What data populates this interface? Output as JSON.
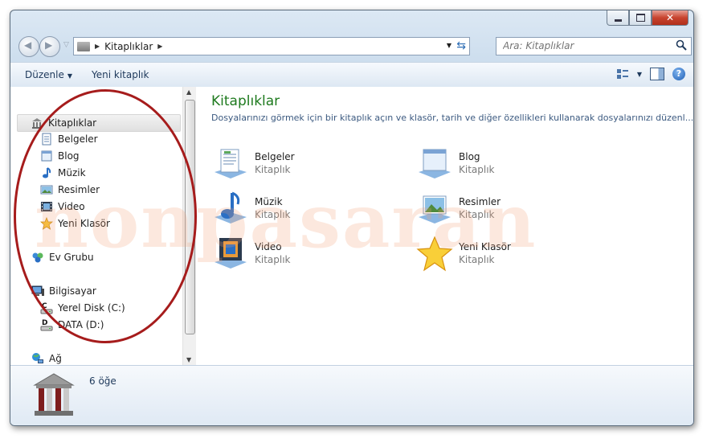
{
  "window": {
    "minimize": "minimize",
    "maximize": "maximize",
    "close": "close"
  },
  "address": {
    "crumb": "Kitaplıklar"
  },
  "search": {
    "placeholder": "Ara: Kitaplıklar"
  },
  "toolbar": {
    "organize_label": "Düzenle",
    "new_library_label": "Yeni kitaplık"
  },
  "sidebar": {
    "items": [
      {
        "label": "Kitaplıklar",
        "icon": "libraries-icon"
      },
      {
        "label": "Belgeler",
        "icon": "documents-icon"
      },
      {
        "label": "Blog",
        "icon": "blog-icon"
      },
      {
        "label": "Müzik",
        "icon": "music-icon"
      },
      {
        "label": "Resimler",
        "icon": "pictures-icon"
      },
      {
        "label": "Video",
        "icon": "video-icon"
      },
      {
        "label": "Yeni Klasör",
        "icon": "star-icon"
      },
      {
        "label": "Ev Grubu",
        "icon": "homegroup-icon"
      },
      {
        "label": "Bilgisayar",
        "icon": "computer-icon"
      },
      {
        "label": "Yerel Disk (C:)",
        "icon": "drive-c-icon"
      },
      {
        "label": "DATA (D:)",
        "icon": "drive-d-icon"
      },
      {
        "label": "Ağ",
        "icon": "network-icon"
      }
    ]
  },
  "main": {
    "title": "Kitaplıklar",
    "description": "Dosyalarınızı görmek için bir kitaplık açın ve klasör, tarih ve diğer özellikleri kullanarak dosyalarınızı düzenl...",
    "libraries": [
      {
        "name": "Belgeler",
        "kind": "Kitaplık",
        "icon": "documents-icon"
      },
      {
        "name": "Blog",
        "kind": "Kitaplık",
        "icon": "blog-icon"
      },
      {
        "name": "Müzik",
        "kind": "Kitaplık",
        "icon": "music-icon"
      },
      {
        "name": "Resimler",
        "kind": "Kitaplık",
        "icon": "pictures-icon"
      },
      {
        "name": "Video",
        "kind": "Kitaplık",
        "icon": "video-icon"
      },
      {
        "name": "Yeni Klasör",
        "kind": "Kitaplık",
        "icon": "star-icon"
      }
    ]
  },
  "details": {
    "count": "6 öğe"
  },
  "watermark": "nonpasaran",
  "colors": {
    "title_green": "#1e7a1e",
    "annotation_red": "#a61c1c",
    "link_blue": "#1e395b"
  }
}
